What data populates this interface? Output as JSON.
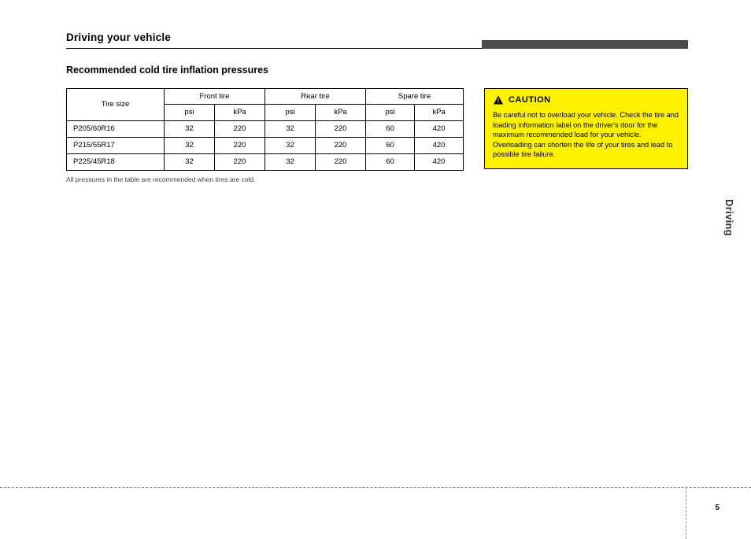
{
  "header": {
    "title": "Driving your vehicle"
  },
  "section": {
    "title": "Recommended cold tire inflation pressures"
  },
  "table": {
    "row_header_label": "Tire size",
    "group_front": "Front tire",
    "group_rear": "Rear tire",
    "group_spare": "Spare tire",
    "col_psi": "psi",
    "col_kpa": "kPa",
    "rows": [
      {
        "label": "P205/60R16",
        "front_psi": "32",
        "front_kpa": "220",
        "rear_psi": "32",
        "rear_kpa": "220",
        "spare_psi": "60",
        "spare_kpa": "420"
      },
      {
        "label": "P215/55R17",
        "front_psi": "32",
        "front_kpa": "220",
        "rear_psi": "32",
        "rear_kpa": "220",
        "spare_psi": "60",
        "spare_kpa": "420"
      },
      {
        "label": "P225/45R18",
        "front_psi": "32",
        "front_kpa": "220",
        "rear_psi": "32",
        "rear_kpa": "220",
        "spare_psi": "60",
        "spare_kpa": "420"
      }
    ]
  },
  "note": "All pressures in the table are recommended when tires are cold.",
  "caution": {
    "label": "CAUTION",
    "body": "Be careful not to overload your vehicle. Check the tire and loading information label on the driver's door for the maximum recommended load for your vehicle. Overloading can shorten the life of your tires and lead to possible tire failure."
  },
  "footer": {
    "page_number": "5",
    "side_caption": "Driving"
  },
  "chart_data": {
    "type": "table",
    "title": "Recommended cold tire inflation pressures",
    "columns": [
      "Tire size",
      "Front psi",
      "Front kPa",
      "Rear psi",
      "Rear kPa",
      "Spare psi",
      "Spare kPa"
    ],
    "rows": [
      [
        "P205/60R16",
        32,
        220,
        32,
        220,
        60,
        420
      ],
      [
        "P215/55R17",
        32,
        220,
        32,
        220,
        60,
        420
      ],
      [
        "P225/45R18",
        32,
        220,
        32,
        220,
        60,
        420
      ]
    ]
  }
}
